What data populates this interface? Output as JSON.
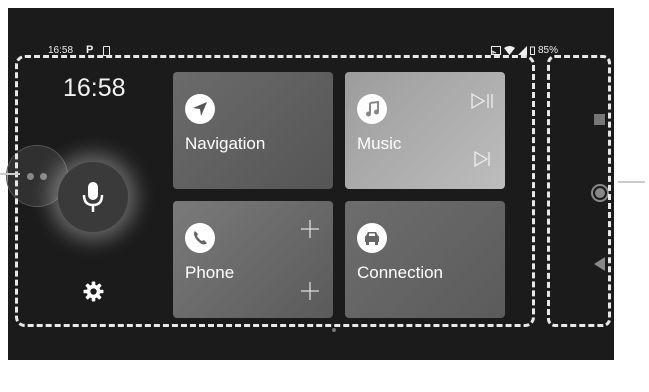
{
  "statusbar": {
    "time": "16:58",
    "notification_letter": "P",
    "battery": "85%"
  },
  "launcher": {
    "clock": "16:58"
  },
  "tiles": {
    "navigation": "Navigation",
    "music": "Music",
    "phone": "Phone",
    "connection": "Connection"
  },
  "colors": {
    "background": "#1b1b1b",
    "tile_dark": "#5f5f5f",
    "tile_light": "#b0b0b0"
  }
}
